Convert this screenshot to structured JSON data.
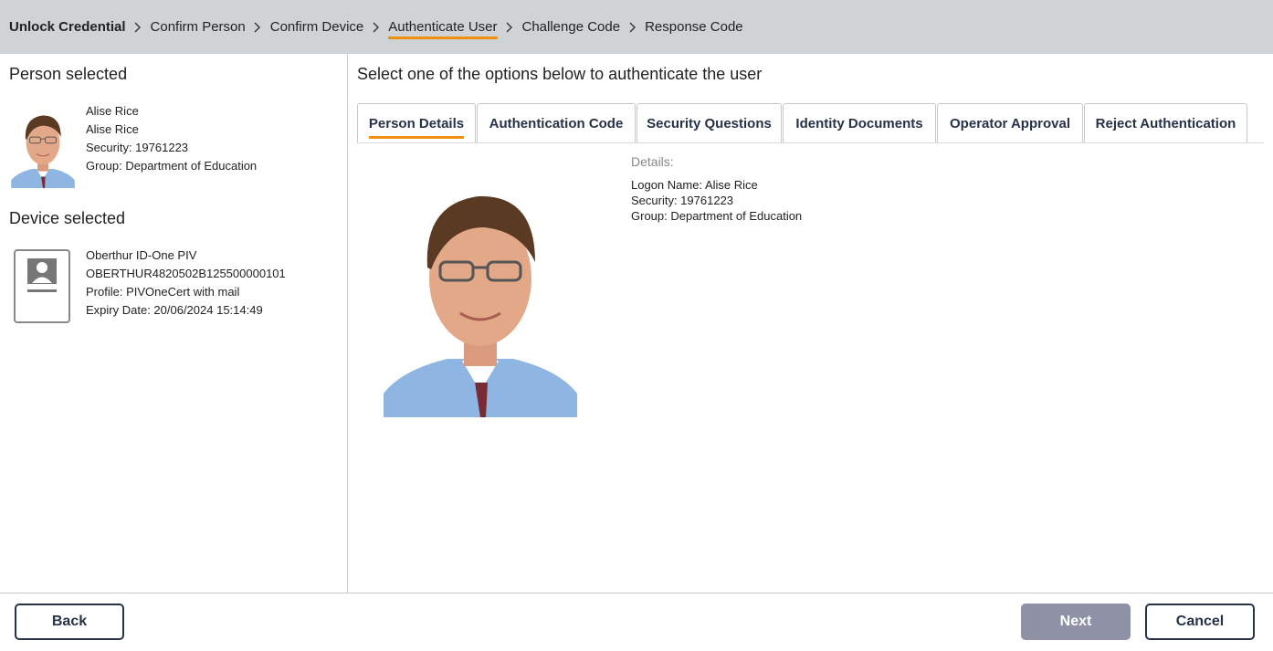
{
  "breadcrumb": {
    "steps": [
      "Unlock Credential",
      "Confirm Person",
      "Confirm Device",
      "Authenticate User",
      "Challenge Code",
      "Response Code"
    ],
    "active_index": 3
  },
  "person_panel": {
    "title": "Person selected",
    "lines": [
      "Alise Rice",
      "Alise Rice",
      "Security: 19761223",
      "Group: Department of Education"
    ]
  },
  "device_panel": {
    "title": "Device selected",
    "lines": [
      "Oberthur ID-One PIV",
      "OBERTHUR4820502B125500000101",
      "Profile: PIVOneCert with mail",
      "Expiry Date: 20/06/2024 15:14:49"
    ]
  },
  "main": {
    "title": "Select one of the options below to authenticate the user",
    "tabs": [
      "Person Details",
      "Authentication Code",
      "Security Questions",
      "Identity Documents",
      "Operator Approval",
      "Reject Authentication"
    ],
    "active_tab": 0,
    "details": {
      "heading": "Details:",
      "lines": [
        "Logon Name: Alise Rice",
        "Security: 19761223",
        "Group: Department of Education"
      ]
    }
  },
  "footer": {
    "back_label": "Back",
    "next_label": "Next",
    "cancel_label": "Cancel"
  },
  "colors": {
    "accent": "#f0900c",
    "header_bg": "#cfd3d6",
    "primary_text": "#27324a",
    "disabled_button": "#8f92a6"
  },
  "icons": {
    "breadcrumb_separator": "chevron-right-icon",
    "device": "smart-card-icon"
  }
}
